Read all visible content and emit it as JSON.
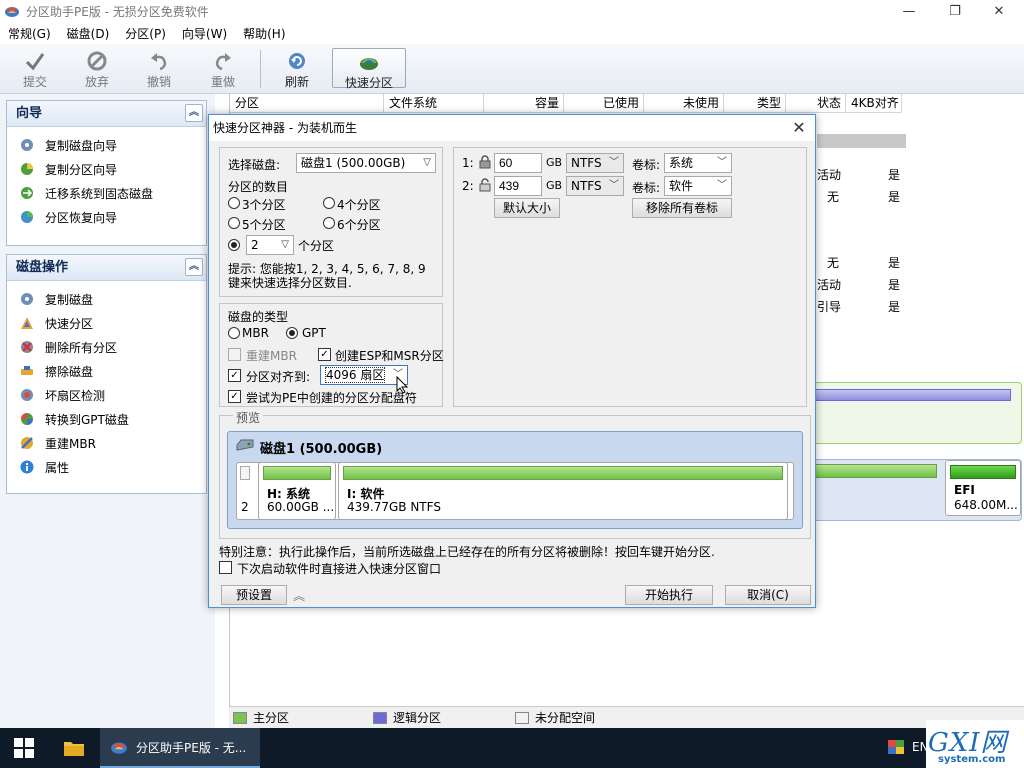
{
  "window": {
    "title": "分区助手PE版 - 无损分区免费软件",
    "controls": [
      "—",
      "❐",
      "✕"
    ]
  },
  "menu": [
    "常规(G)",
    "磁盘(D)",
    "分区(P)",
    "向导(W)",
    "帮助(H)"
  ],
  "toolbar": {
    "commit": "提交",
    "discard": "放弃",
    "undo": "撤销",
    "redo": "重做",
    "refresh": "刷新",
    "quick_partition": "快速分区"
  },
  "sidebar": {
    "wizard": {
      "title": "向导",
      "items": [
        "复制磁盘向导",
        "复制分区向导",
        "迁移系统到固态磁盘",
        "分区恢复向导"
      ]
    },
    "disk_ops": {
      "title": "磁盘操作",
      "items": [
        "复制磁盘",
        "快速分区",
        "删除所有分区",
        "擦除磁盘",
        "坏扇区检测",
        "转换到GPT磁盘",
        "重建MBR",
        "属性"
      ]
    }
  },
  "main": {
    "columns": [
      "分区",
      "文件系统",
      "容量",
      "已使用",
      "未使用",
      "类型",
      "状态",
      "4KB对齐"
    ],
    "status_col": [
      "活动",
      "无",
      "无",
      "活动",
      "引导"
    ],
    "align_col": [
      "是",
      "是",
      "是",
      "是",
      "是"
    ],
    "efi_label": "EFI",
    "efi_size": "648.00M..."
  },
  "legend": {
    "primary": "主分区",
    "logical": "逻辑分区",
    "unallocated": "未分配空间"
  },
  "dialog": {
    "title": "快速分区神器 - 为装机而生",
    "select_disk_label": "选择磁盘:",
    "select_disk_value": "磁盘1 (500.00GB)",
    "partition_count_label": "分区的数目",
    "options": [
      "3个分区",
      "4个分区",
      "5个分区",
      "6个分区"
    ],
    "custom_count": "2",
    "custom_suffix": "个分区",
    "hint": "提示: 您能按1, 2, 3, 4, 5, 6, 7, 8, 9键来快速选择分区数目.",
    "disk_type_label": "磁盘的类型",
    "mbr": "MBR",
    "gpt": "GPT",
    "rebuild_mbr": "重建MBR",
    "create_esp": "创建ESP和MSR分区",
    "align_label": "分区对齐到:",
    "align_value": "4096 扇区",
    "try_assign": "尝试为PE中创建的分区分配盘符",
    "partitions": [
      {
        "index": "1:",
        "size": "60",
        "unit": "GB",
        "fs": "NTFS",
        "vol_label": "卷标:",
        "vol_value": "系统"
      },
      {
        "index": "2:",
        "size": "439",
        "unit": "GB",
        "fs": "NTFS",
        "vol_label": "卷标:",
        "vol_value": "软件"
      }
    ],
    "default_size": "默认大小",
    "remove_labels": "移除所有卷标",
    "preview_label": "预览",
    "disk_name": "磁盘1 (500.00GB)",
    "preview_index": "2",
    "preview_parts": [
      {
        "name": "H: 系统",
        "size": "60.00GB ..."
      },
      {
        "name": "I: 软件",
        "size": "439.77GB NTFS"
      }
    ],
    "warning": "特别注意：执行此操作后，当前所选磁盘上已经存在的所有分区将被删除！按回车键开始分区.",
    "next_start": "下次启动软件时直接进入快速分区窗口",
    "presets": "预设置",
    "start": "开始执行",
    "cancel": "取消(C)"
  },
  "taskbar": {
    "app": "分区助手PE版 - 无...",
    "lang": "EN"
  },
  "watermark": {
    "brand": "GXI网",
    "site": "system.com"
  },
  "colors": {
    "accent": "#4a90d9",
    "primary_partition": "#7cc34f",
    "logical_partition": "#6b6bd6",
    "taskbar": "#0e1a27"
  }
}
